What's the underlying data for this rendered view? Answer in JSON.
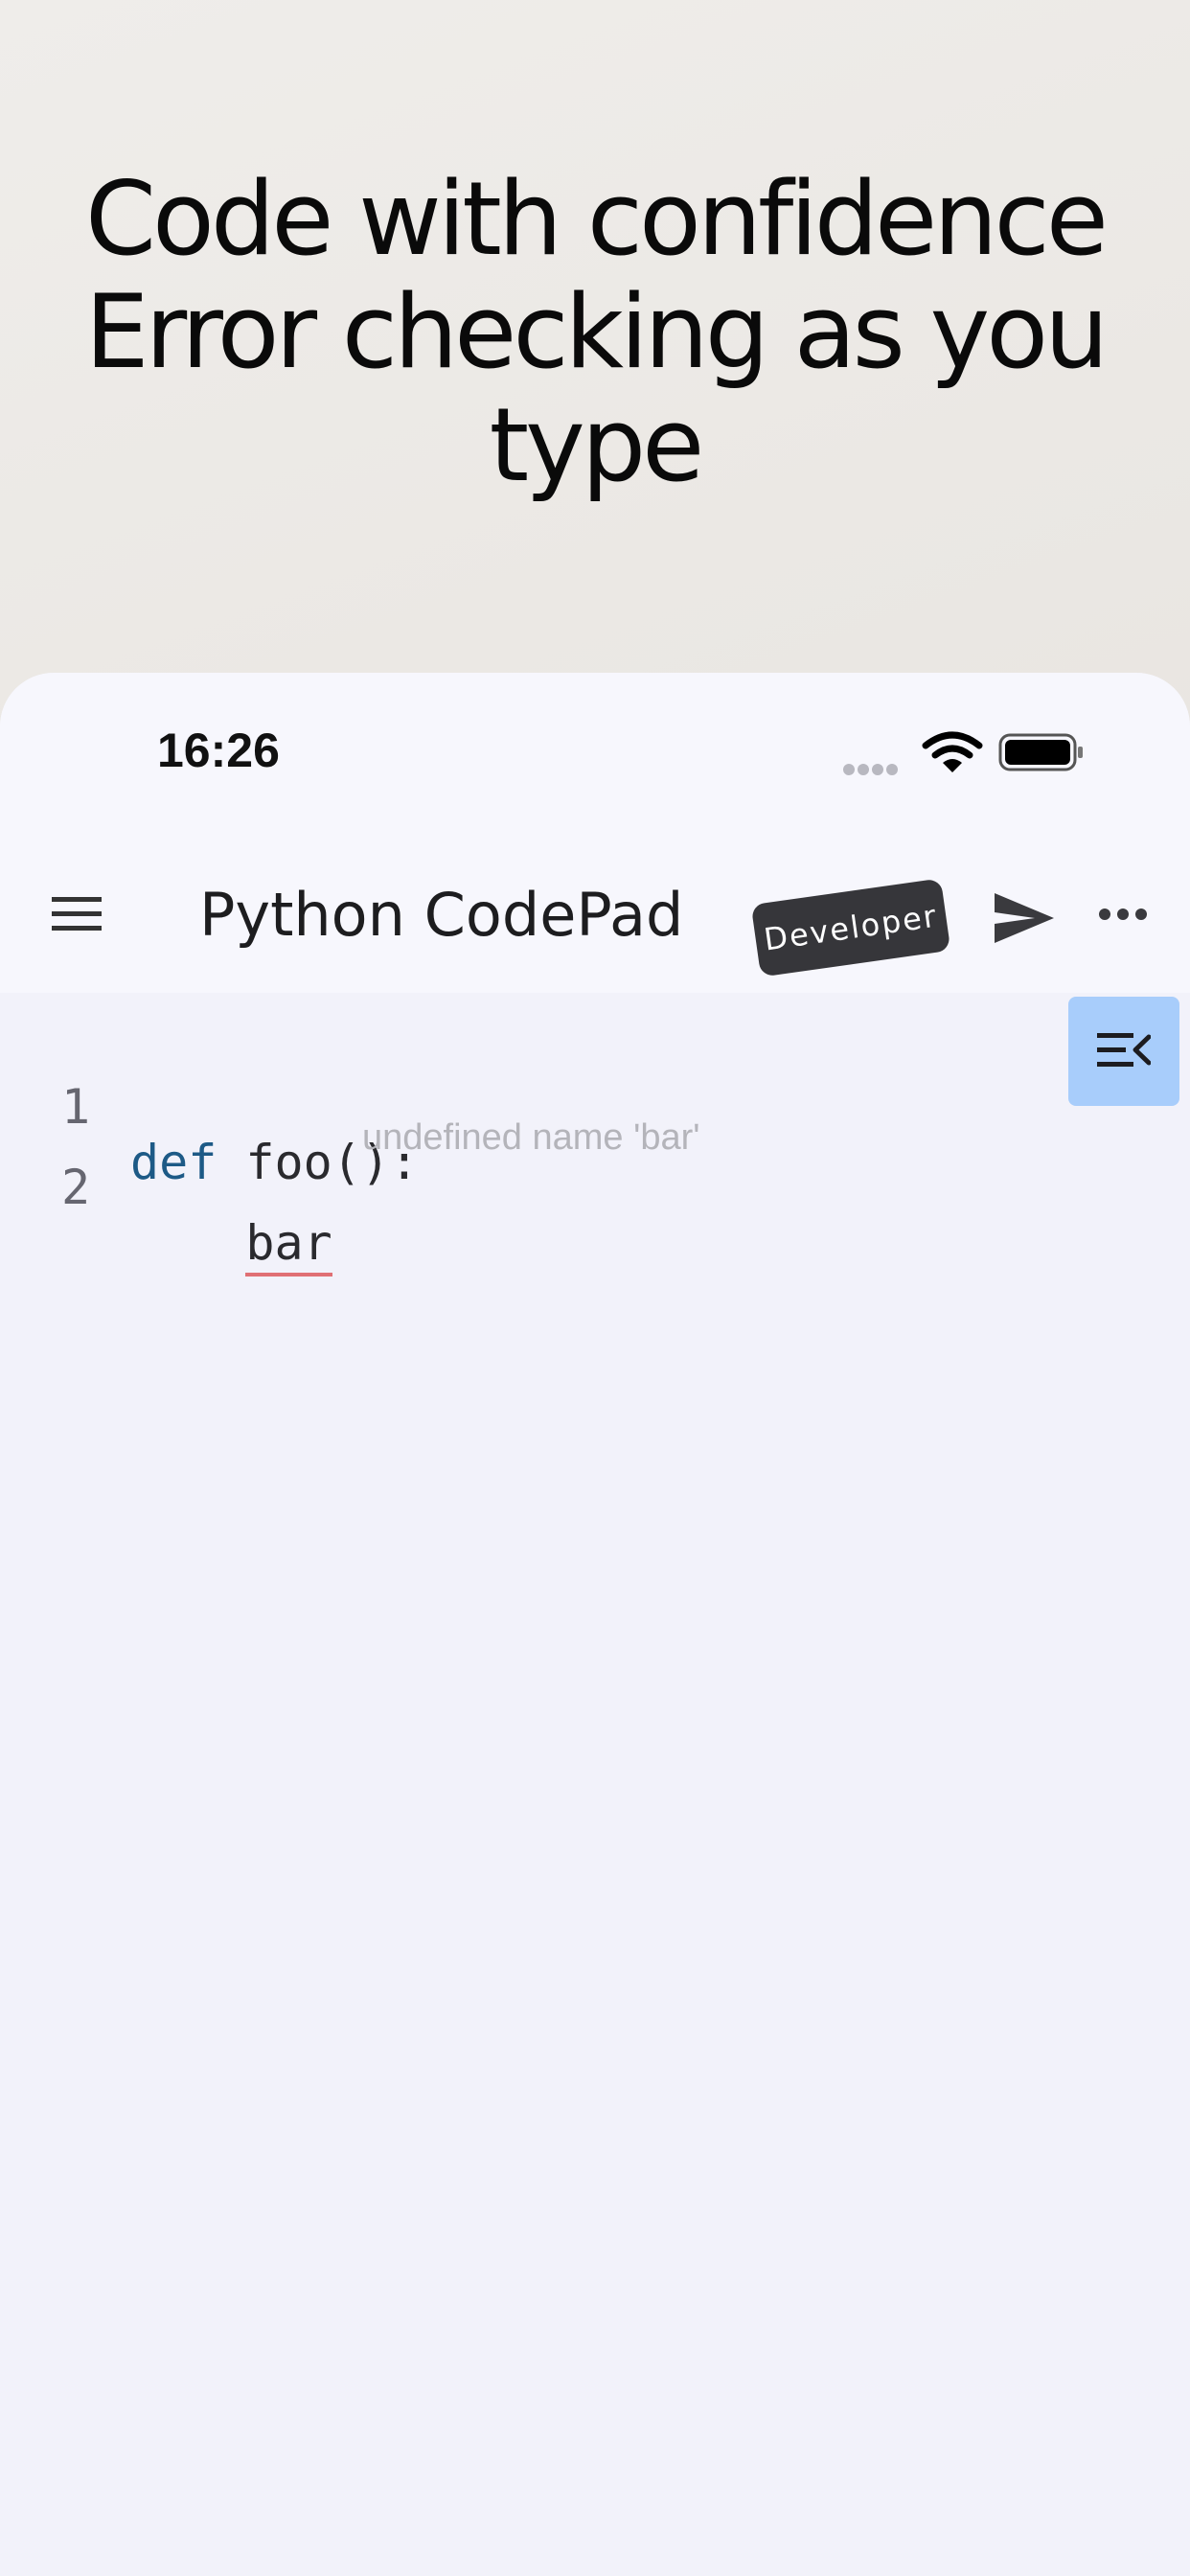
{
  "promo": {
    "headline_lines": [
      "Code with confidence",
      "Error checking as you",
      "type"
    ]
  },
  "status_bar": {
    "time": "16:26",
    "icons": [
      "signal-icon",
      "wifi-icon",
      "battery-icon"
    ]
  },
  "app_bar": {
    "title": "Python CodePad",
    "badge": "Developer",
    "icons": [
      "menu-icon",
      "send-icon",
      "more-icon"
    ]
  },
  "editor": {
    "lines": [
      {
        "number": "1",
        "keyword": "def",
        "text": " foo():"
      },
      {
        "number": "2",
        "indent": "    ",
        "error_token": "bar",
        "hint": "undefined name 'bar'"
      }
    ],
    "panel_button_icon": "collapse-panel-icon",
    "colors": {
      "keyword": "#1d5a86",
      "error_underline": "#e07074",
      "panel_button": "#a8cdfb"
    }
  }
}
